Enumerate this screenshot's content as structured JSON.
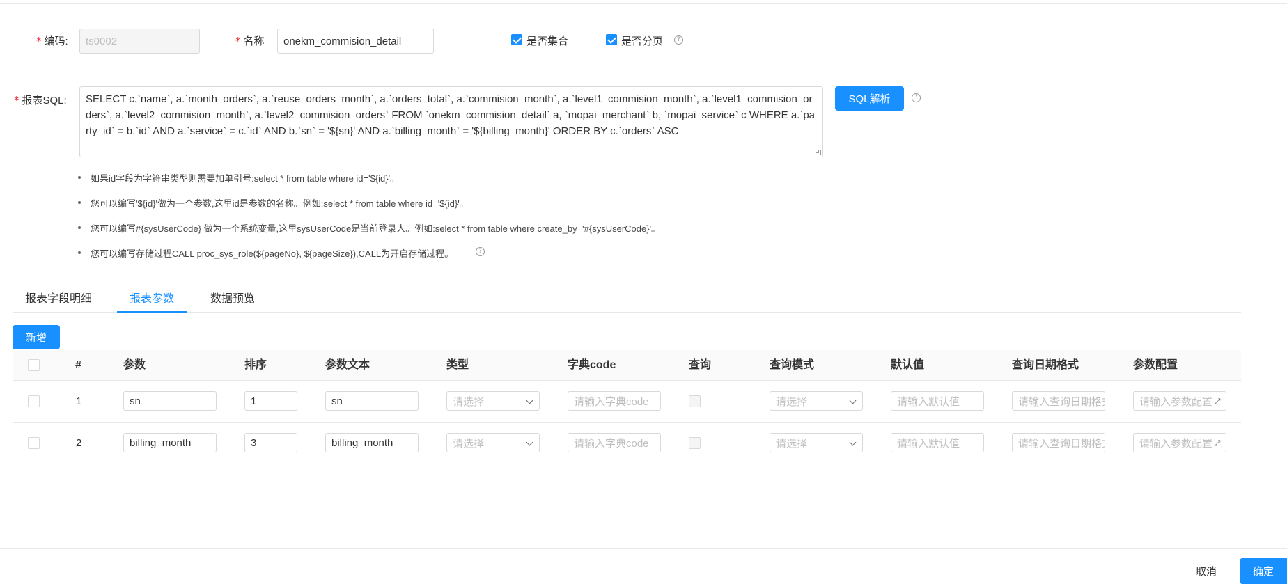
{
  "form": {
    "code_label": "编码:",
    "code_value": "ts0002",
    "name_label": "名称",
    "name_value": "onekm_commision_detail",
    "is_set_label": "是否集合",
    "is_paged_label": "是否分页",
    "sql_label": "报表SQL:",
    "sql_value": "SELECT c.`name`, a.`month_orders`, a.`reuse_orders_month`, a.`orders_total`, a.`commision_month`, a.`level1_commision_month`, a.`level1_commision_orders`, a.`level2_commision_month`, a.`level2_commision_orders` FROM `onekm_commision_detail` a, `mopai_merchant` b, `mopai_service` c WHERE a.`party_id` = b.`id` AND a.`service` = c.`id` AND b.`sn` = '${sn}' AND a.`billing_month` = '${billing_month}' ORDER BY c.`orders` ASC",
    "sql_parse_button": "SQL解析",
    "help_glyph": "?"
  },
  "tips": [
    "如果id字段为字符串类型则需要加单引号:select * from table where id='${id}'。",
    "您可以编写'${id}'做为一个参数,这里id是参数的名称。例如:select * from table where id='${id}'。",
    "您可以编写#{sysUserCode} 做为一个系统变量,这里sysUserCode是当前登录人。例如:select * from table where create_by='#{sysUserCode}'。",
    "您可以编写存储过程CALL proc_sys_role(${pageNo}, ${pageSize}),CALL为开启存储过程。"
  ],
  "tabs": [
    "报表字段明细",
    "报表参数",
    "数据预览"
  ],
  "active_tab": "报表参数",
  "add_button": "新增",
  "table": {
    "headers": [
      "#",
      "参数",
      "排序",
      "参数文本",
      "类型",
      "字典code",
      "查询",
      "查询模式",
      "默认值",
      "查询日期格式",
      "参数配置"
    ],
    "placeholders": {
      "type": "请选择",
      "dict_code": "请输入字典code",
      "mode": "请选择",
      "default": "请输入默认值",
      "date_format": "请输入查询日期格式",
      "config": "请输入参数配置"
    },
    "rows": [
      {
        "index": "1",
        "param": "sn",
        "order": "1",
        "text": "sn"
      },
      {
        "index": "2",
        "param": "billing_month",
        "order": "3",
        "text": "billing_month"
      }
    ]
  },
  "footer": {
    "cancel": "取消",
    "confirm": "确定"
  },
  "icons": {
    "expand": "⤢"
  }
}
